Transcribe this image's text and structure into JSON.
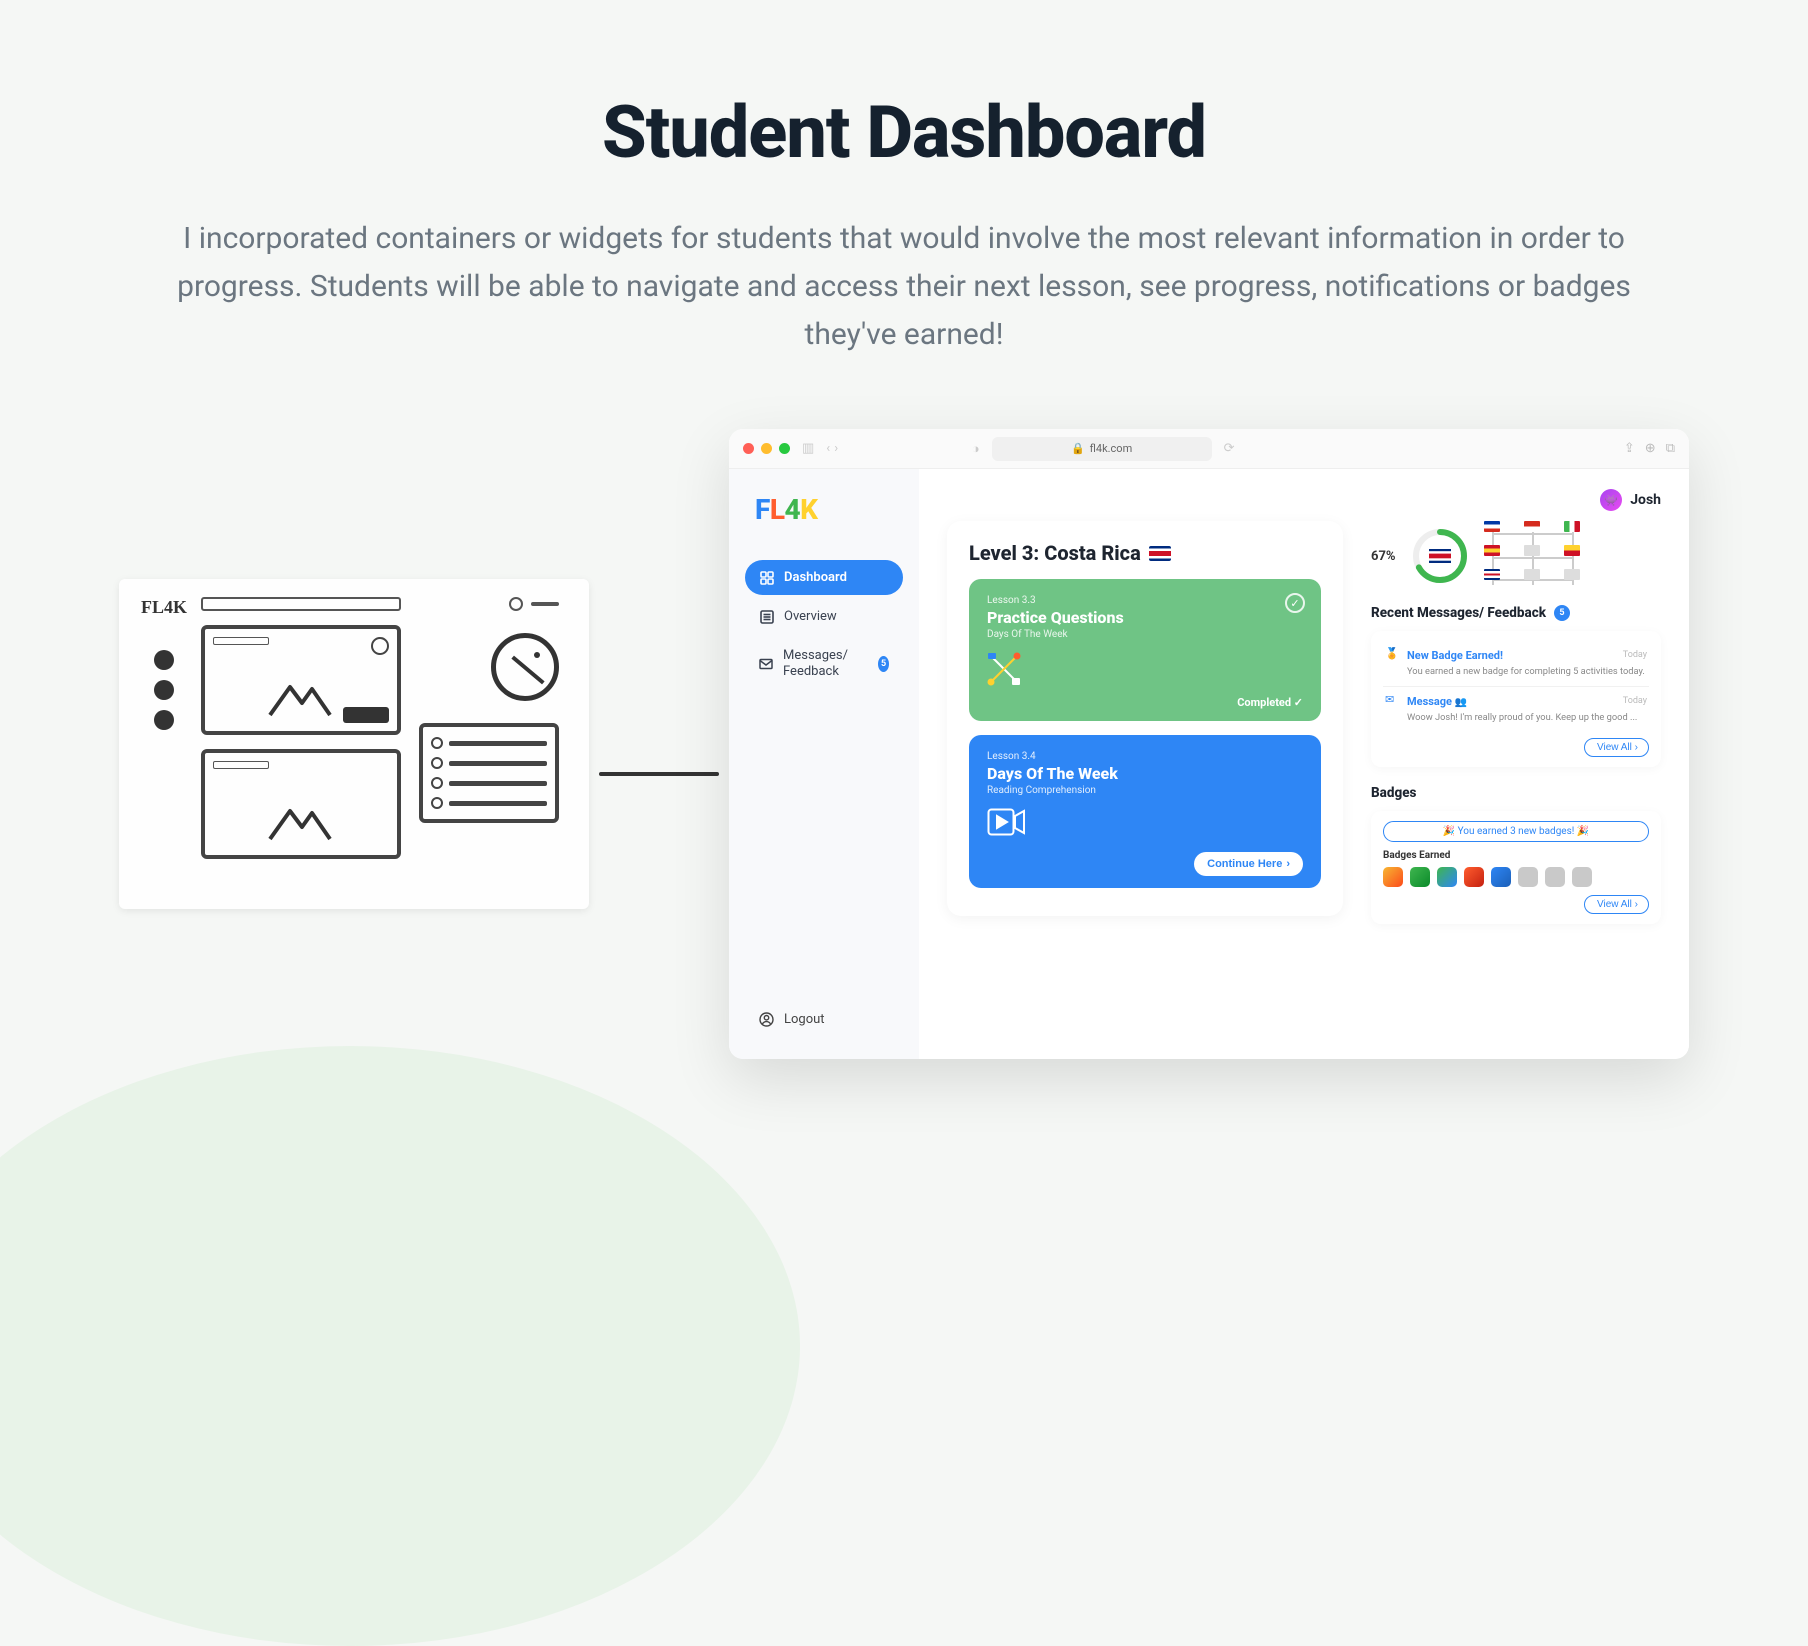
{
  "page": {
    "title": "Student Dashboard",
    "description": "I incorporated containers or widgets for students that would involve the most relevant information in order to progress. Students will be able to navigate and access their next lesson, see progress, notifications or badges they've earned!"
  },
  "sketch": {
    "logo": "FL4K"
  },
  "browser": {
    "url": "fl4k.com"
  },
  "sidebar": {
    "logo": "FL4K",
    "items": [
      {
        "icon": "grid",
        "label": "Dashboard",
        "active": true
      },
      {
        "icon": "list",
        "label": "Overview"
      },
      {
        "icon": "mail",
        "label": "Messages/ Feedback",
        "badge": "5"
      }
    ],
    "logout": "Logout"
  },
  "user": {
    "name": "Josh"
  },
  "level": {
    "title": "Level 3: Costa Rica",
    "lessons": [
      {
        "sub": "Lesson 3.3",
        "title": "Practice Questions",
        "meta": "Days Of The Week",
        "status": "Completed ✓",
        "completed": true
      },
      {
        "sub": "Lesson 3.4",
        "title": "Days Of The Week",
        "meta": "Reading Comprehension",
        "cta": "Continue Here"
      }
    ]
  },
  "progress": {
    "pct_label": "67%",
    "pct": 67
  },
  "messages": {
    "heading": "Recent Messages/ Feedback",
    "badge": "5",
    "items": [
      {
        "icon": "trophy",
        "title": "New Badge Earned!",
        "time": "Today",
        "body": "You earned a new badge for completing 5 activities today."
      },
      {
        "icon": "mail",
        "title": "Message",
        "extra": "👥",
        "time": "Today",
        "body": "Woow Josh! I'm really proud of you. Keep up the good ..."
      }
    ],
    "view_all": "View All"
  },
  "badges": {
    "heading": "Badges",
    "banner": "🎉 You earned 3 new badges! 🎉",
    "sub": "Badges Earned",
    "view_all": "View All"
  }
}
